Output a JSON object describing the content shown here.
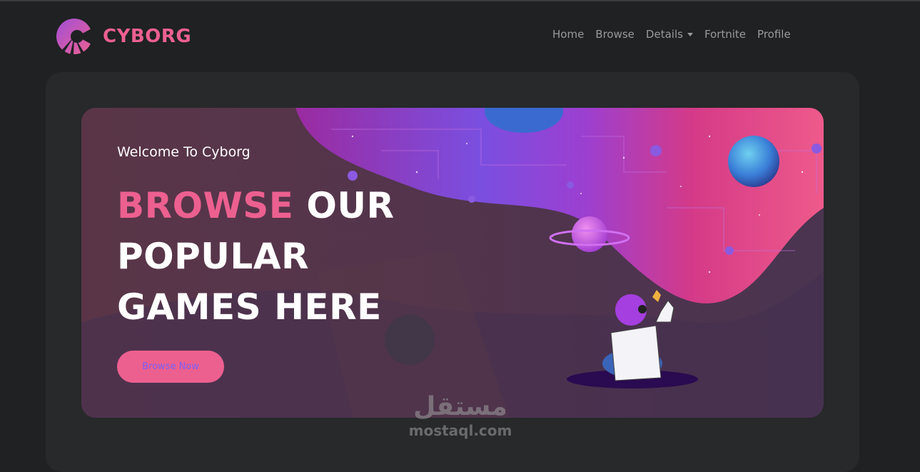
{
  "brand": {
    "name": "CYBORG",
    "accent_color": "#ec6090",
    "logo_icon": "cyborg-logo-icon"
  },
  "nav": {
    "items": [
      {
        "label": "Home"
      },
      {
        "label": "Browse"
      },
      {
        "label": "Details",
        "has_dropdown": true
      },
      {
        "label": "Fortnite"
      },
      {
        "label": "Profile"
      }
    ]
  },
  "banner": {
    "welcome": "Welcome To Cyborg",
    "headline_highlight": "BROWSE",
    "headline_rest": " OUR POPULAR GAMES HERE",
    "button_label": "Browse Now",
    "illustration": "space-illustration"
  },
  "watermark": {
    "arabic": "مستقل",
    "latin": "mostaql.com"
  },
  "colors": {
    "background": "#1f2122",
    "panel": "#27292a",
    "accent": "#ec6090",
    "button_text": "#7a5ff5"
  }
}
